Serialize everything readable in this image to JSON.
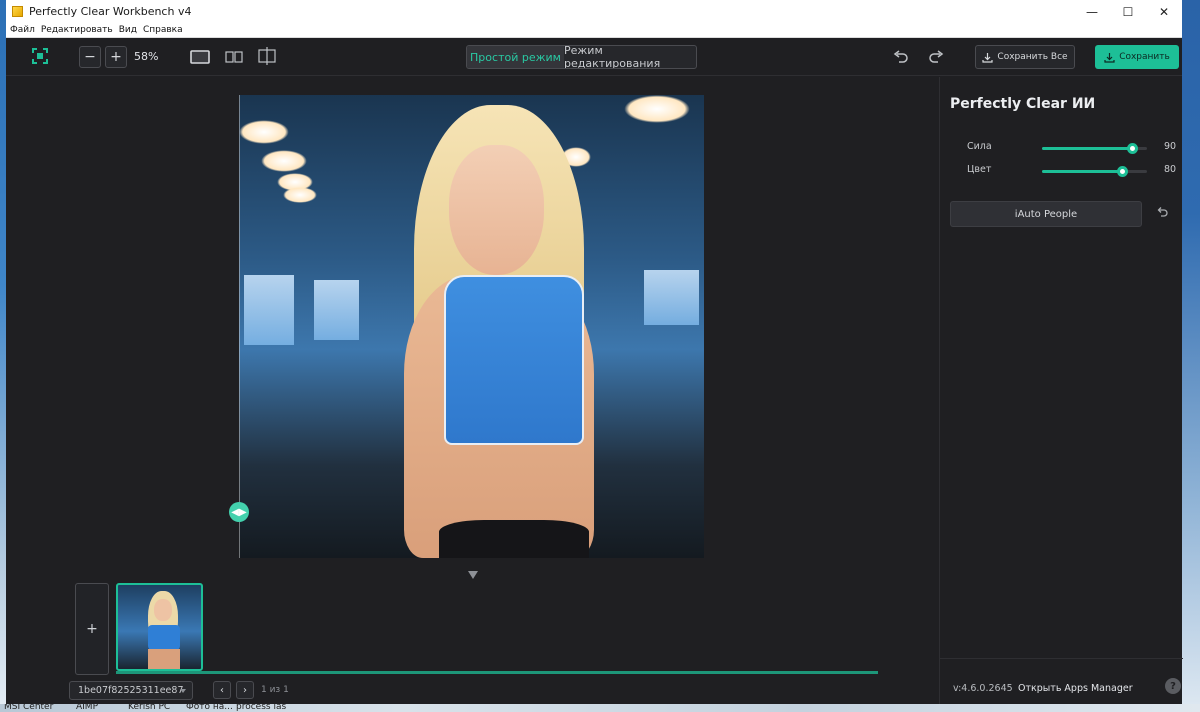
{
  "window": {
    "title": "Perfectly Clear Workbench v4",
    "controls": {
      "minimize": "—",
      "maximize": "☐",
      "close": "✕"
    }
  },
  "menu": [
    "Файл",
    "Редактировать",
    "Вид",
    "Справка"
  ],
  "toolbar": {
    "zoom_out": "−",
    "zoom_in": "+",
    "zoom_level": "58%",
    "mode_simple": "Простой режим",
    "mode_edit": "Режим редактирования",
    "save_all": "Сохранить Все",
    "save": "Сохранить"
  },
  "canvas": {
    "split_handle": "◀▶"
  },
  "filmstrip": {
    "add": "+",
    "file_name": "1be07f82525311ee87",
    "prev": "‹",
    "next": "›",
    "page_count": "1 из 1"
  },
  "panel": {
    "title": "Perfectly Clear ИИ",
    "sliders": [
      {
        "label": "Сила",
        "value": "90",
        "level": 0.86
      },
      {
        "label": "Цвет",
        "value": "80",
        "level": 0.76
      }
    ],
    "preset_button": "iAuto People",
    "version": "v:4.6.0.2645",
    "apps_manager": "Открыть Apps Manager",
    "help": "?"
  },
  "taskbar": [
    "MSI Center",
    "AIMP",
    "Kerish PC",
    "Фото на...",
    "process las"
  ],
  "accent_color": "#1dbf97"
}
